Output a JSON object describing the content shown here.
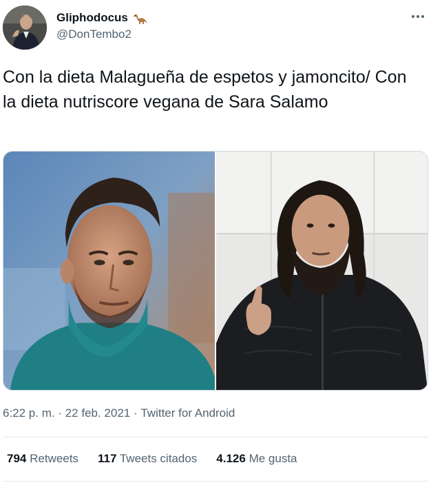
{
  "author": {
    "display_name": "Gliphodocus",
    "name_emoji_icon": "sauropod-icon",
    "handle": "@DonTembo2",
    "avatar": "profile-photo"
  },
  "tweet": {
    "text": "Con la dieta Malagueña de espetos y jamoncito/ Con la dieta nutriscore vegana de Sara Salamo",
    "media": [
      {
        "description_icon": "photo-left"
      },
      {
        "description_icon": "photo-right"
      }
    ],
    "timestamp_time": "6:22 p. m.",
    "separator": " · ",
    "timestamp_date": "22 feb. 2021",
    "source": "Twitter for Android"
  },
  "stats": {
    "retweets_count": "794",
    "retweets_label": "Retweets",
    "quotes_count": "117",
    "quotes_label": "Tweets citados",
    "likes_count": "4.126",
    "likes_label": "Me gusta"
  },
  "colors": {
    "text_primary": "#0f1419",
    "text_secondary": "#536471",
    "divider": "#e4e9ec"
  }
}
